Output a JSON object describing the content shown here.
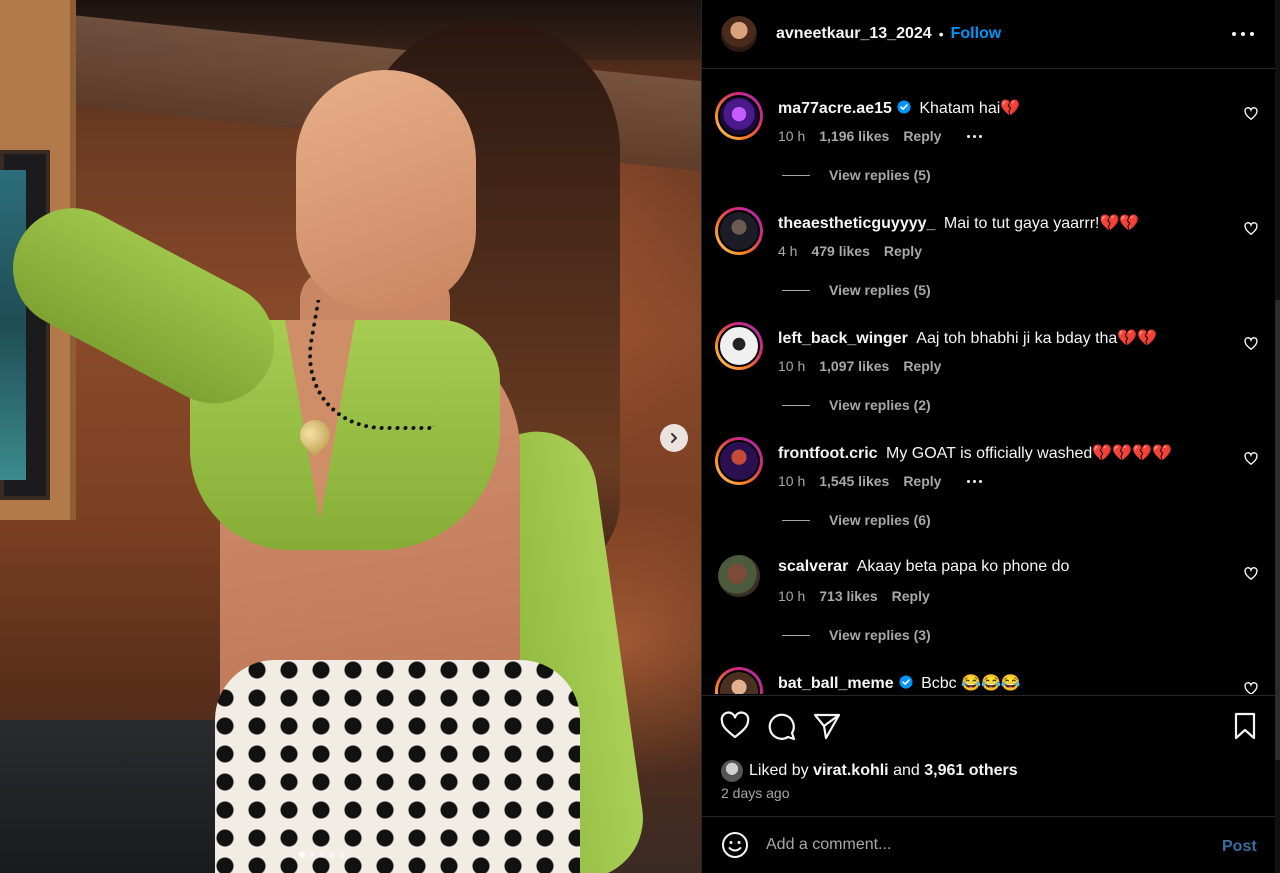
{
  "post": {
    "username": "avneetkaur_13_2024",
    "separator": "•",
    "follow_label": "Follow"
  },
  "comments": [
    {
      "user": "ma77acre.ae15",
      "verified": true,
      "text": "Khatam hai💔",
      "time": "10 h",
      "likes": "1,196 likes",
      "reply": "Reply",
      "view_replies": "View replies (5)",
      "avatar_color": "#6a2bd0"
    },
    {
      "user": "theaestheticguyyyy_",
      "verified": false,
      "text": "Mai to tut gaya yaarrr!💔💔",
      "time": "4 h",
      "likes": "479 likes",
      "reply": "Reply",
      "view_replies": "View replies (5)",
      "avatar_color": "#2a2a3a"
    },
    {
      "user": "left_back_winger",
      "verified": false,
      "text": "Aaj toh bhabhi ji ka bday tha💔💔",
      "time": "10 h",
      "likes": "1,097 likes",
      "reply": "Reply",
      "view_replies": "View replies (2)",
      "avatar_color": "#e8e8e8"
    },
    {
      "user": "frontfoot.cric",
      "verified": false,
      "text": "My GOAT is officially washed💔💔💔💔",
      "time": "10 h",
      "likes": "1,545 likes",
      "reply": "Reply",
      "view_replies": "View replies (6)",
      "avatar_color": "#3a1450"
    },
    {
      "user": "scalverar",
      "verified": false,
      "text": "Akaay beta papa ko phone do",
      "time": "10 h",
      "likes": "713 likes",
      "reply": "Reply",
      "view_replies": "View replies (3)",
      "avatar_color": "#4a3a2a"
    },
    {
      "user": "bat_ball_meme",
      "verified": true,
      "text": "Bcbc 😂😂😂",
      "time": "",
      "likes": "",
      "reply": "",
      "view_replies": "",
      "avatar_color": "#7a5a3a"
    }
  ],
  "footer": {
    "liked_by_prefix": "Liked by",
    "liked_by_user": "virat.kohli",
    "and": "and",
    "others": "3,961 others",
    "time_ago": "2 days ago",
    "comment_placeholder": "Add a comment...",
    "post_label": "Post"
  },
  "colors": {
    "accent": "#0095f6",
    "post_disabled": "#3a6fa0",
    "muted": "#a8a8a8",
    "background": "#000000"
  },
  "icons": [
    "chevron-right-icon",
    "more-icon",
    "verified-icon",
    "heart-icon",
    "comment-icon",
    "share-icon",
    "bookmark-icon",
    "emoji-icon"
  ]
}
